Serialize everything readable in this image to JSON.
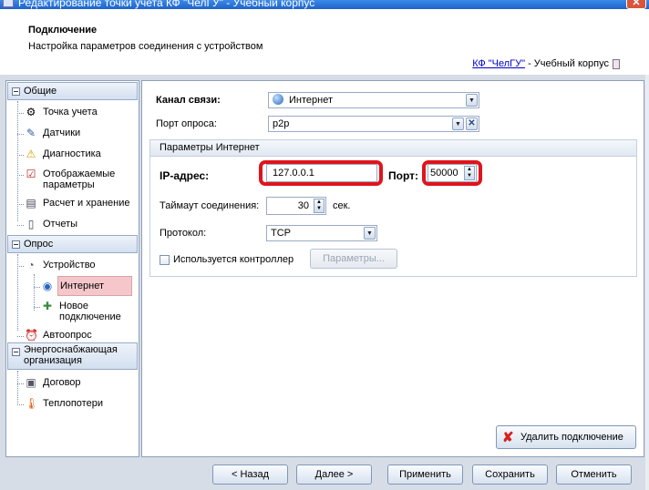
{
  "window": {
    "title": "Редактирование точки учета КФ \"ЧелГУ\" - Учебный корпус"
  },
  "header": {
    "title": "Подключение",
    "subtitle": "Настройка параметров соединения с устройством",
    "link_text": "КФ \"ЧелГУ\"",
    "link_suffix": " - Учебный корпус"
  },
  "sidebar": {
    "groups": {
      "general": "Общие",
      "poll": "Опрос",
      "energy": "Энергоснабжающая организация"
    },
    "items": {
      "point": "Точка учета",
      "sensors": "Датчики",
      "diagnostics": "Диагностика",
      "displayed": "Отображаемые параметры",
      "calc": "Расчет и хранение",
      "reports": "Отчеты",
      "device": "Устройство",
      "internet": "Интернет",
      "new_conn": "Новое подключение",
      "autopoll": "Автоопрос",
      "contract": "Договор",
      "heatloss": "Теплопотери"
    }
  },
  "form": {
    "channel_label": "Канал связи:",
    "channel_value": "Интернет",
    "port_poll_label": "Порт опроса:",
    "port_poll_value": "p2p",
    "section_title": "Параметры Интернет",
    "ip_label": "IP-адрес:",
    "ip_value": "127.0.0.1",
    "port_label": "Порт:",
    "port_value": "50000",
    "timeout_label": "Таймаут соединения:",
    "timeout_value": "30",
    "timeout_unit": "сек.",
    "protocol_label": "Протокол:",
    "protocol_value": "TCP",
    "controller_label": "Используется контроллер",
    "controller_checked": false,
    "params_button": "Параметры...",
    "delete_button": "Удалить подключение"
  },
  "footer": {
    "back": "< Назад",
    "next": "Далее >",
    "apply": "Применить",
    "save": "Сохранить",
    "cancel": "Отменить"
  },
  "colors": {
    "highlight": "#e0141c",
    "selected_item": "#f5c7cb"
  }
}
